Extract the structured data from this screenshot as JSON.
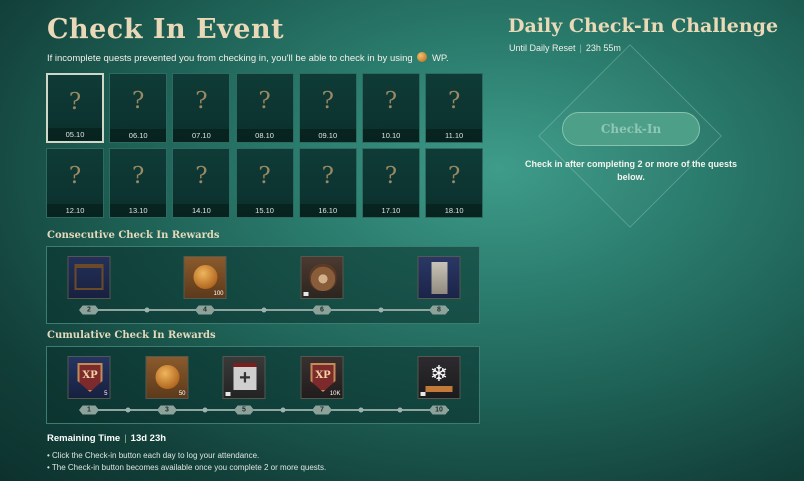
{
  "event": {
    "title": "Check In Event",
    "subtitle_before": "If incomplete quests prevented you from checking in, you'll be able to check in by using",
    "subtitle_after": "WP.",
    "wp_icon": "coin-icon"
  },
  "days": [
    {
      "mark": "?",
      "date": "05.10",
      "current": true
    },
    {
      "mark": "?",
      "date": "06.10"
    },
    {
      "mark": "?",
      "date": "07.10"
    },
    {
      "mark": "?",
      "date": "08.10"
    },
    {
      "mark": "?",
      "date": "09.10"
    },
    {
      "mark": "?",
      "date": "10.10"
    },
    {
      "mark": "?",
      "date": "11.10"
    },
    {
      "mark": "?",
      "date": "12.10"
    },
    {
      "mark": "?",
      "date": "13.10"
    },
    {
      "mark": "?",
      "date": "14.10"
    },
    {
      "mark": "?",
      "date": "15.10"
    },
    {
      "mark": "?",
      "date": "16.10"
    },
    {
      "mark": "?",
      "date": "17.10"
    },
    {
      "mark": "?",
      "date": "18.10"
    }
  ],
  "consecutive": {
    "label": "Consecutive Check In Rewards",
    "milestones": [
      "2",
      "4",
      "6",
      "8"
    ],
    "rewards": [
      {
        "icon": "frame-icon",
        "count": ""
      },
      {
        "icon": "gold-coin-icon",
        "count": "100"
      },
      {
        "icon": "bear-icon",
        "count": ""
      },
      {
        "icon": "scroll-icon",
        "count": ""
      }
    ]
  },
  "cumulative": {
    "label": "Cumulative Check In Rewards",
    "milestones": [
      "1",
      "3",
      "5",
      "7",
      "10"
    ],
    "rewards": [
      {
        "icon": "xp-boost-icon",
        "count": "5",
        "glyph": "XP"
      },
      {
        "icon": "gold-coin-icon",
        "count": "50"
      },
      {
        "icon": "medkit-icon",
        "count": ""
      },
      {
        "icon": "xp-icon",
        "count": "10K",
        "glyph": "XP"
      },
      {
        "icon": "snowflake-icon",
        "count": ""
      }
    ]
  },
  "daily": {
    "title": "Daily Check-In Challenge",
    "reset_label": "Until Daily Reset",
    "reset_time": "23h 55m",
    "button_label": "Check-In",
    "note": "Check in after completing 2 or more of the quests below."
  },
  "remaining": {
    "label": "Remaining Time",
    "value": "13d 23h"
  },
  "notes": [
    "• Click the Check-in button each day to log your attendance.",
    "• The Check-in button becomes available once you complete 2 or more quests."
  ]
}
